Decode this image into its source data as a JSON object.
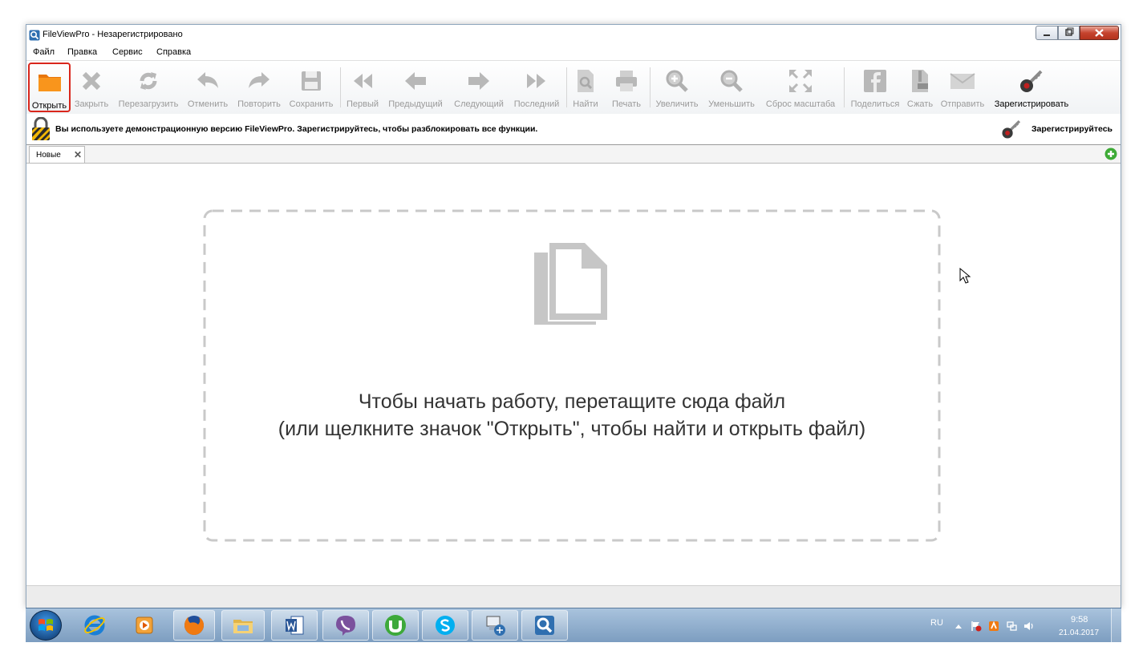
{
  "window": {
    "title": "FileViewPro - Незарегистрировано"
  },
  "menu": [
    "Файл",
    "Правка",
    "Сервис",
    "Справка"
  ],
  "toolbar": {
    "open": "Открыть",
    "close": "Закрыть",
    "reload": "Перезагрузить",
    "undo": "Отменить",
    "redo": "Повторить",
    "save": "Сохранить",
    "first": "Первый",
    "prev": "Предыдущий",
    "next": "Следующий",
    "last": "Последний",
    "find": "Найти",
    "print": "Печать",
    "zoom_in": "Увеличить",
    "zoom_out": "Уменьшить",
    "zoom_reset": "Сброс масштаба",
    "share": "Поделиться",
    "compress": "Сжать",
    "send": "Отправить",
    "register": "Зарегистрировать"
  },
  "notice": {
    "text": "Вы используете демонстрационную версию FileViewPro. Зарегистрируйтесь, чтобы разблокировать все функции.",
    "register_link": "Зарегистрируйтесь"
  },
  "tabs": [
    {
      "label": "Новые"
    }
  ],
  "dropzone": {
    "line1": "Чтобы начать работу, перетащите сюда файл",
    "line2": "(или щелкните значок \"Открыть\", чтобы найти и открыть файл)"
  },
  "taskbar": {
    "language": "RU",
    "time": "9:58",
    "date": "21.04.2017",
    "apps": [
      "ie-icon",
      "media-player-icon",
      "firefox-icon",
      "explorer-icon",
      "word-icon",
      "viber-icon",
      "utorrent-icon",
      "skype-icon",
      "network-tool-icon",
      "fileviewpro-icon"
    ]
  },
  "colors": {
    "accent_red": "#d9261c",
    "disabled_icon": "#b8b8b8",
    "open_folder": "#f08a12"
  }
}
